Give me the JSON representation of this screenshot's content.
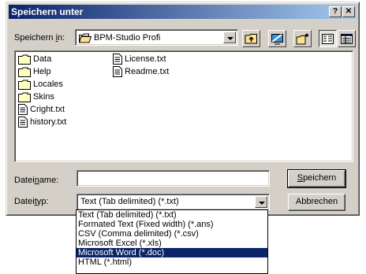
{
  "window": {
    "title": "Speichern unter"
  },
  "title_buttons": {
    "help": "?",
    "close": "✕"
  },
  "location": {
    "label_pre": "Speichern ",
    "label_key": "i",
    "label_post": "n:",
    "value": "BPM-Studio Profi"
  },
  "files": [
    {
      "name": "Data",
      "icon": "folder-icon"
    },
    {
      "name": "Help",
      "icon": "folder-icon"
    },
    {
      "name": "Locales",
      "icon": "folder-icon"
    },
    {
      "name": "Skins",
      "icon": "folder-icon"
    },
    {
      "name": "Cright.txt",
      "icon": "text-file-icon"
    },
    {
      "name": "history.txt",
      "icon": "text-file-icon"
    },
    {
      "name": "License.txt",
      "icon": "text-file-icon"
    },
    {
      "name": "Readme.txt",
      "icon": "text-file-icon"
    }
  ],
  "filename": {
    "label_pre": "Datei",
    "label_key": "n",
    "label_post": "ame:",
    "value": ""
  },
  "filetype": {
    "label_pre": "Datei",
    "label_key": "t",
    "label_post": "yp:",
    "value": "Text (Tab delimited) (*.txt)"
  },
  "buttons": {
    "save_key": "S",
    "save_rest": "peichern",
    "cancel": "Abbrechen"
  },
  "dropdown_options": [
    {
      "label": "Text (Tab delimited) (*.txt)",
      "selected": false
    },
    {
      "label": "Formated Text (Fixed width)  (*.ans)",
      "selected": false
    },
    {
      "label": "CSV (Comma delimited) (*.csv)",
      "selected": false
    },
    {
      "label": "Microsoft Excel (*.xls)",
      "selected": false
    },
    {
      "label": "Microsoft Word (*.doc)",
      "selected": true
    },
    {
      "label": "HTML (*.html)",
      "selected": false
    }
  ]
}
